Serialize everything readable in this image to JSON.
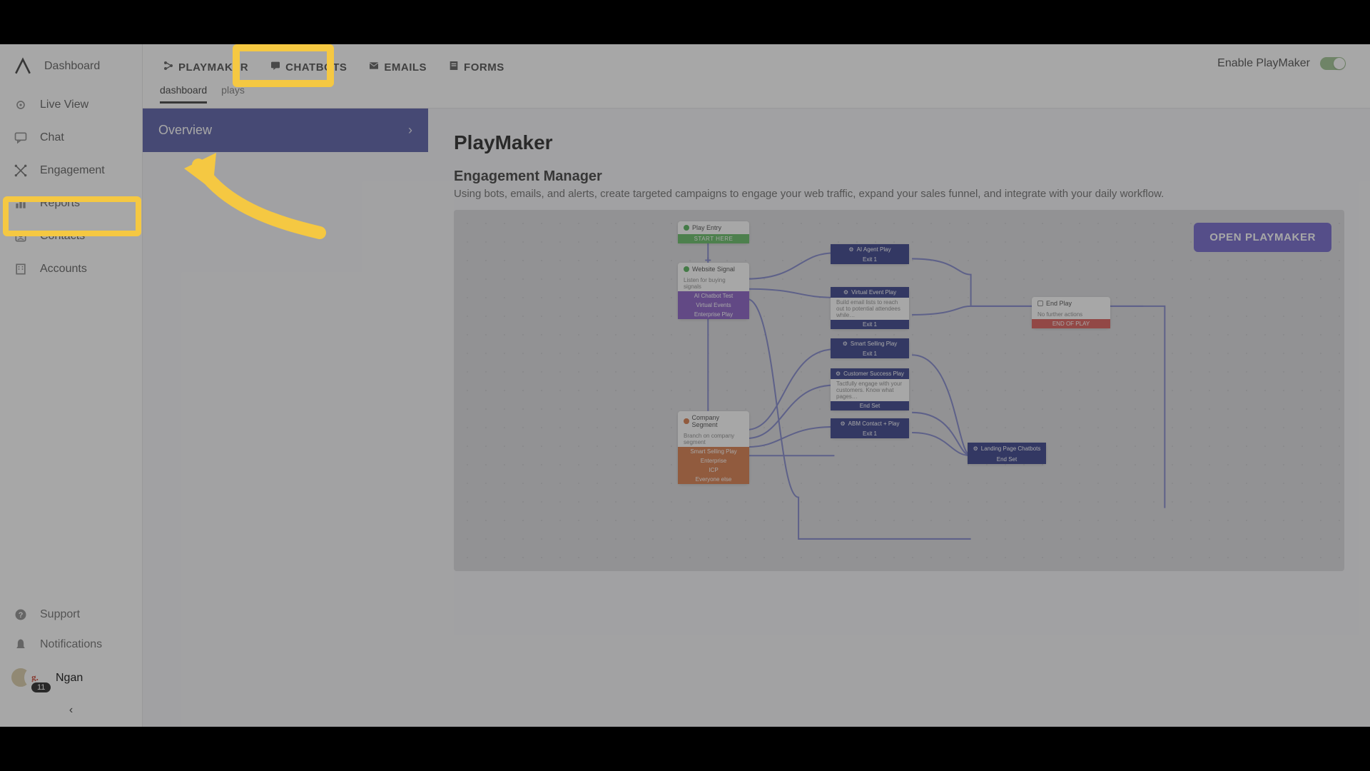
{
  "sidebar": {
    "items": [
      {
        "label": "Dashboard",
        "icon": "logo"
      },
      {
        "label": "Live View",
        "icon": "eye"
      },
      {
        "label": "Chat",
        "icon": "chat"
      },
      {
        "label": "Engagement",
        "icon": "engagement"
      },
      {
        "label": "Reports",
        "icon": "chart"
      },
      {
        "label": "Contacts",
        "icon": "contact"
      },
      {
        "label": "Accounts",
        "icon": "accounts"
      }
    ],
    "support": "Support",
    "notifications": "Notifications",
    "user_name": "Ngan",
    "badge_count": "11",
    "avatar_letter": "g."
  },
  "topbar": {
    "tabs": [
      {
        "label": "PLAYMAKER",
        "icon": "flow"
      },
      {
        "label": "CHATBOTS",
        "icon": "chat-square"
      },
      {
        "label": "EMAILS",
        "icon": "mail"
      },
      {
        "label": "FORMS",
        "icon": "form"
      }
    ],
    "subtabs": [
      "dashboard",
      "plays"
    ],
    "enable_label": "Enable PlayMaker"
  },
  "sidepanel": {
    "overview": "Overview"
  },
  "page": {
    "title": "PlayMaker",
    "subtitle": "Engagement Manager",
    "description": "Using bots, emails, and alerts, create targeted campaigns to engage your web traffic, expand your sales funnel, and integrate with your daily workflow.",
    "open_button": "OPEN PLAYMAKER"
  },
  "flow": {
    "play_entry": {
      "title": "Play Entry",
      "cta": "START HERE"
    },
    "website_signal": {
      "title": "Website Signal",
      "sub": "Listen for buying signals",
      "bars": [
        "AI Chatbot Test",
        "Virtual Events",
        "Enterprise Play"
      ]
    },
    "company_segment": {
      "title": "Company Segment",
      "sub": "Branch on company segment",
      "bars": [
        "Smart Selling Play",
        "Enterprise",
        "ICP",
        "Everyone else"
      ]
    },
    "ai_agent": {
      "title": "AI Agent Play",
      "bar": "Exit 1"
    },
    "virtual_event": {
      "title": "Virtual Event Play",
      "sub": "Build email lists to reach out to potential attendees while…",
      "bar": "Exit 1"
    },
    "smart_selling": {
      "title": "Smart Selling Play",
      "bar": "Exit 1"
    },
    "customer_success": {
      "title": "Customer Success Play",
      "sub": "Tactfully engage with your customers. Know what pages…",
      "bar": "End Set"
    },
    "abm_contact": {
      "title": "ABM Contact + Play",
      "bar": "Exit 1"
    },
    "landing_page": {
      "title": "Landing Page Chatbots",
      "bar": "End Set"
    },
    "end_play": {
      "title": "End Play",
      "sub": "No further actions",
      "bar": "END OF PLAY"
    }
  }
}
